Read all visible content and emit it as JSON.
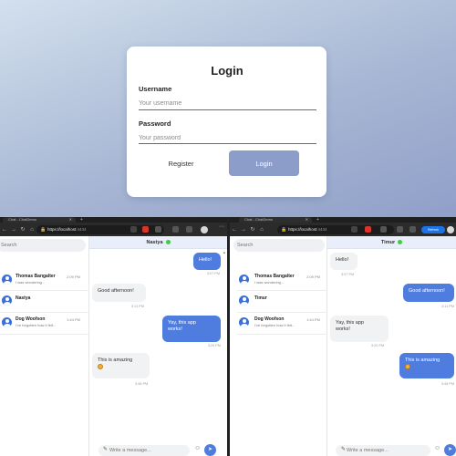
{
  "login": {
    "title": "Login",
    "username_label": "Username",
    "username_placeholder": "Your username",
    "password_label": "Password",
    "password_placeholder": "Your password",
    "register_label": "Register",
    "login_label": "Login"
  },
  "left_window": {
    "tab_title": "Chat - ChatDemo",
    "address": "https://localhost",
    "address_port": ":4434",
    "search_placeholder": "Search",
    "contacts": [
      {
        "name": "Thomas Bangalter",
        "time": "2:09 PM",
        "preview": "I was wondering..."
      },
      {
        "name": "Nastya",
        "time": "",
        "preview": ""
      },
      {
        "name": "Dog Woofson",
        "time": "1:44 PM",
        "preview": "I've forgotten how it felt..."
      }
    ],
    "chat_title": "Nastya",
    "messages": [
      {
        "text": "Hello!",
        "time": "3:07 PM"
      },
      {
        "text": "Good afternoon!",
        "time": "3:11 PM"
      },
      {
        "text": "Yay, this app works!",
        "time": "3:20 PM"
      },
      {
        "text": "This is amazing",
        "time": "3:48 PM"
      }
    ],
    "composer_placeholder": "Write a message..."
  },
  "right_window": {
    "tab_title": "Chat - ChatDemo",
    "address": "https://localhost",
    "address_port": ":4434",
    "refresh_label": "Refresh",
    "search_placeholder": "Search",
    "contacts": [
      {
        "name": "Thomas Bangalter",
        "time": "2:09 PM",
        "preview": "I was wondering..."
      },
      {
        "name": "Timur",
        "time": "",
        "preview": ""
      },
      {
        "name": "Dog Woofson",
        "time": "1:44 PM",
        "preview": "I've forgotten how it felt..."
      }
    ],
    "chat_title": "Timur",
    "messages": [
      {
        "text": "Hello!",
        "time": "3:07 PM"
      },
      {
        "text": "Good afternoon!",
        "time": "3:11 PM"
      },
      {
        "text": "Yay, this app works!",
        "time": "3:20 PM"
      },
      {
        "text": "This is amazing",
        "time": "3:48 PM"
      }
    ],
    "composer_placeholder": "Write a message..."
  },
  "colors": {
    "accent": "#4f7ddf",
    "login_button": "#8c9dc9",
    "online": "#3ecf3e"
  }
}
